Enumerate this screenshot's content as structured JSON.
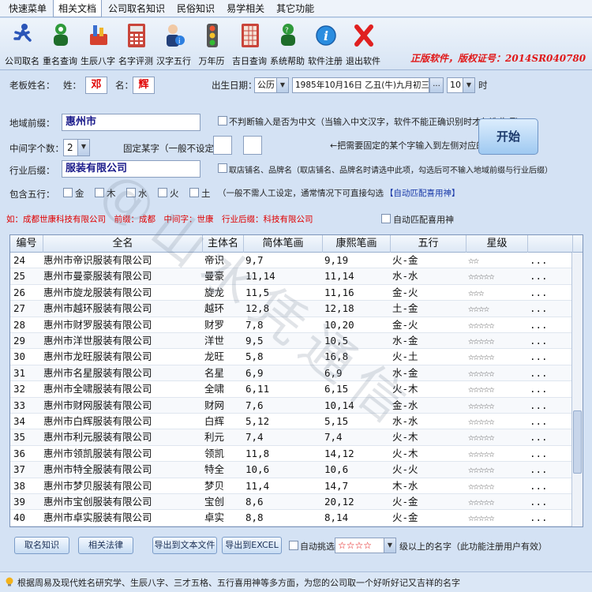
{
  "menubar": {
    "items": [
      "快速菜单",
      "相关文档",
      "公司取名知识",
      "民俗知识",
      "易学相关",
      "其它功能"
    ]
  },
  "toolbar": {
    "tools": [
      {
        "label": "公司取名",
        "icon": "runner-icon"
      },
      {
        "label": "重名查询",
        "icon": "person-search-icon"
      },
      {
        "label": "生辰八字",
        "icon": "toolbox-icon"
      },
      {
        "label": "名字评测",
        "icon": "calculator-icon"
      },
      {
        "label": "汉字五行",
        "icon": "person-info-icon"
      },
      {
        "label": "万年历",
        "icon": "traffic-light-icon"
      },
      {
        "label": "吉日查询",
        "icon": "calendar-grid-icon"
      },
      {
        "label": "系统帮助",
        "icon": "help-person-icon"
      },
      {
        "label": "软件注册",
        "icon": "info-icon"
      },
      {
        "label": "退出软件",
        "icon": "close-icon"
      }
    ],
    "license_text": "正版软件，版权证号：2014SR040780"
  },
  "form": {
    "boss_name_label": "老板姓名：",
    "surname_label": "姓：",
    "surname_value": "邓",
    "given_label": "名：",
    "given_value": "辉",
    "birth_label": "出生日期：",
    "calendar_value": "公历",
    "birth_date_value": "1985年10月16日 乙丑(牛)九月初三",
    "browse_label": "...",
    "hour_value": "10",
    "hour_unit": "时",
    "region_label": "地域前缀：",
    "region_value": "惠州市",
    "no_check_label": "不判断输入是否为中文（当输入中文汉字，软件不能正确识别时才勾选此项）",
    "middle_count_label": "中间字个数：",
    "middle_count_value": "2",
    "fixed_char_label": "固定某字（一般不设定）",
    "fixed_hint": "←把需要固定的某个字输入到左侧对应的框中",
    "industry_label": "行业后缀：",
    "industry_value": "服装有限公司",
    "shop_name_label": "取店铺名、品牌名（取店铺名、品牌名时请选中此项，勾选后可不输入地域前缀与行业后缀）",
    "wuxing_label": "包含五行：",
    "wuxing_options": [
      "金",
      "木",
      "水",
      "火",
      "土"
    ],
    "wuxing_hint": "（一般不需人工设定，通常情况下可直接勾选",
    "auto_match_link": "【自动匹配喜用神】",
    "example_text": "如：成都世康科技有限公司　前缀：成都　中间字：世康　行业后缀：科技有限公司",
    "auto_match_label": "自动匹配喜用神",
    "start_label": "开始"
  },
  "grid": {
    "headers": [
      "编号",
      "全名",
      "主体名",
      "简体笔画",
      "康熙笔画",
      "五行",
      "星级"
    ],
    "rows": [
      {
        "no": "24",
        "name": "惠州市帝识服装有限公司",
        "core": "帝识",
        "simp": "9,7",
        "kx": "9,19",
        "wx": "火-金",
        "stars": "☆☆",
        "more": "..."
      },
      {
        "no": "25",
        "name": "惠州市曼豪服装有限公司",
        "core": "曼豪",
        "simp": "11,14",
        "kx": "11,14",
        "wx": "水-水",
        "stars": "☆☆☆☆☆",
        "more": "..."
      },
      {
        "no": "26",
        "name": "惠州市旋龙服装有限公司",
        "core": "旋龙",
        "simp": "11,5",
        "kx": "11,16",
        "wx": "金-火",
        "stars": "☆☆☆",
        "more": "..."
      },
      {
        "no": "27",
        "name": "惠州市越环服装有限公司",
        "core": "越环",
        "simp": "12,8",
        "kx": "12,18",
        "wx": "土-金",
        "stars": "☆☆☆☆",
        "more": "..."
      },
      {
        "no": "28",
        "name": "惠州市财罗服装有限公司",
        "core": "财罗",
        "simp": "7,8",
        "kx": "10,20",
        "wx": "金-火",
        "stars": "☆☆☆☆☆",
        "more": "..."
      },
      {
        "no": "29",
        "name": "惠州市洋世服装有限公司",
        "core": "洋世",
        "simp": "9,5",
        "kx": "10,5",
        "wx": "水-金",
        "stars": "☆☆☆☆☆",
        "more": "..."
      },
      {
        "no": "30",
        "name": "惠州市龙旺服装有限公司",
        "core": "龙旺",
        "simp": "5,8",
        "kx": "16,8",
        "wx": "火-土",
        "stars": "☆☆☆☆☆",
        "more": "..."
      },
      {
        "no": "31",
        "name": "惠州市名星服装有限公司",
        "core": "名星",
        "simp": "6,9",
        "kx": "6,9",
        "wx": "水-金",
        "stars": "☆☆☆☆☆",
        "more": "..."
      },
      {
        "no": "32",
        "name": "惠州市全啸服装有限公司",
        "core": "全啸",
        "simp": "6,11",
        "kx": "6,15",
        "wx": "火-木",
        "stars": "☆☆☆☆☆",
        "more": "..."
      },
      {
        "no": "33",
        "name": "惠州市财网服装有限公司",
        "core": "财网",
        "simp": "7,6",
        "kx": "10,14",
        "wx": "金-水",
        "stars": "☆☆☆☆☆",
        "more": "..."
      },
      {
        "no": "34",
        "name": "惠州市白辉服装有限公司",
        "core": "白辉",
        "simp": "5,12",
        "kx": "5,15",
        "wx": "水-水",
        "stars": "☆☆☆☆☆",
        "more": "..."
      },
      {
        "no": "35",
        "name": "惠州市利元服装有限公司",
        "core": "利元",
        "simp": "7,4",
        "kx": "7,4",
        "wx": "火-木",
        "stars": "☆☆☆☆☆",
        "more": "..."
      },
      {
        "no": "36",
        "name": "惠州市领凯服装有限公司",
        "core": "领凯",
        "simp": "11,8",
        "kx": "14,12",
        "wx": "火-木",
        "stars": "☆☆☆☆☆",
        "more": "..."
      },
      {
        "no": "37",
        "name": "惠州市特全服装有限公司",
        "core": "特全",
        "simp": "10,6",
        "kx": "10,6",
        "wx": "火-火",
        "stars": "☆☆☆☆☆",
        "more": "..."
      },
      {
        "no": "38",
        "name": "惠州市梦贝服装有限公司",
        "core": "梦贝",
        "simp": "11,4",
        "kx": "14,7",
        "wx": "木-水",
        "stars": "☆☆☆☆☆",
        "more": "..."
      },
      {
        "no": "39",
        "name": "惠州市宝创服装有限公司",
        "core": "宝创",
        "simp": "8,6",
        "kx": "20,12",
        "wx": "火-金",
        "stars": "☆☆☆☆☆",
        "more": "..."
      },
      {
        "no": "40",
        "name": "惠州市卓实服装有限公司",
        "core": "卓实",
        "simp": "8,8",
        "kx": "8,14",
        "wx": "火-金",
        "stars": "☆☆☆☆☆",
        "more": "..."
      }
    ]
  },
  "bottom": {
    "naming_knowledge": "取名知识",
    "related_law": "相关法律",
    "export_text": "导出到文本文件",
    "export_excel": "导出到EXCEL",
    "auto_pick_label": "自动挑选",
    "star_select_value": "☆☆☆☆",
    "star_hint": "级以上的名字（此功能注册用户有效）"
  },
  "status": {
    "text": "根据周易及现代姓名研究学、生辰八字、三才五格、五行喜用神等多方面，为您的公司取一个好听好记又吉祥的名字"
  },
  "watermark": {
    "text": "@山水凭通信"
  }
}
